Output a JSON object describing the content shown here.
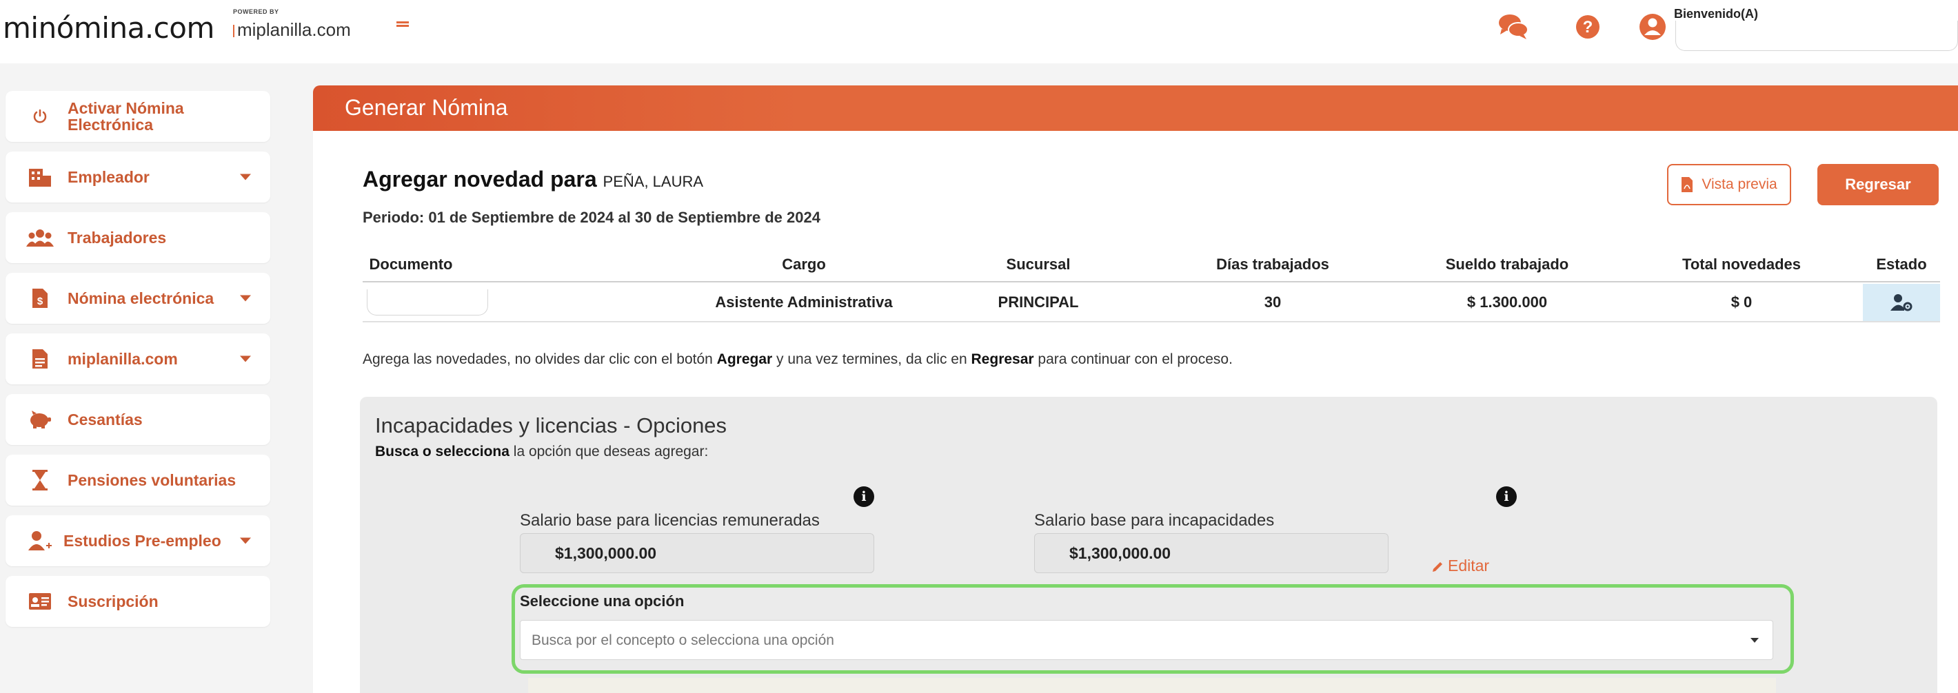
{
  "header": {
    "logo_text": "minómina.com",
    "powered_by": "POWERED BY",
    "partner_logo": "miplanilla.com",
    "icons": [
      "chat-icon",
      "help-icon",
      "user-icon"
    ],
    "welcome": "Bienvenido(A)"
  },
  "sidebar": {
    "items": [
      {
        "label": "Activar Nómina Electrónica",
        "icon": "power-icon",
        "caret": false
      },
      {
        "label": "Empleador",
        "icon": "building-icon",
        "caret": true
      },
      {
        "label": "Trabajadores",
        "icon": "users-icon",
        "caret": false
      },
      {
        "label": "Nómina electrónica",
        "icon": "invoice-dollar-icon",
        "caret": true
      },
      {
        "label": "miplanilla.com",
        "icon": "file-icon",
        "caret": true
      },
      {
        "label": "Cesantías",
        "icon": "piggy-bank-icon",
        "caret": false
      },
      {
        "label": "Pensiones voluntarias",
        "icon": "hourglass-icon",
        "caret": false
      },
      {
        "label": "Estudios Pre-empleo",
        "icon": "user-plus-icon",
        "caret": true
      },
      {
        "label": "Suscripción",
        "icon": "id-card-icon",
        "caret": false
      }
    ]
  },
  "banner": {
    "title": "Generar Nómina"
  },
  "main": {
    "agregar_prefix": "Agregar novedad para",
    "worker_name": "PEÑA, LAURA",
    "periodo": "Periodo: 01 de Septiembre de 2024 al 30 de Septiembre de 2024",
    "vista_previa": "Vista previa",
    "regresar": "Regresar"
  },
  "table": {
    "headers": [
      "Documento",
      "Cargo",
      "Sucursal",
      "Días trabajados",
      "Sueldo trabajado",
      "Total novedades",
      "Estado"
    ],
    "row": {
      "documento": "",
      "cargo": "Asistente Administrativa",
      "sucursal": "PRINCIPAL",
      "dias": "30",
      "sueldo": "$ 1.300.000",
      "total": "$ 0",
      "estado_icon": "user-gear-icon"
    }
  },
  "instructions": {
    "part1": "Agrega las novedades, no olvides dar clic con el botón ",
    "bold1": "Agregar",
    "part2": " y una vez termines, da clic en ",
    "bold2": "Regresar",
    "part3": " para continuar con el proceso."
  },
  "options": {
    "title": "Incapacidades y licencias - Opciones",
    "subtitle_bold": "Busca o selecciona",
    "subtitle_rest": " la opción que deseas agregar:",
    "salario_licencias_label": "Salario base para licencias remuneradas",
    "salario_licencias_value": "$1,300,000.00",
    "salario_incap_label": "Salario base para incapacidades",
    "salario_incap_value": "$1,300,000.00",
    "editar": "Editar",
    "select_label": "Seleccione una opción",
    "select_placeholder": "Busca por el concepto o selecciona una opción"
  },
  "colors": {
    "accent": "#e2683c",
    "highlight": "#7dd66a",
    "estado_bg": "#d9ecf7"
  }
}
